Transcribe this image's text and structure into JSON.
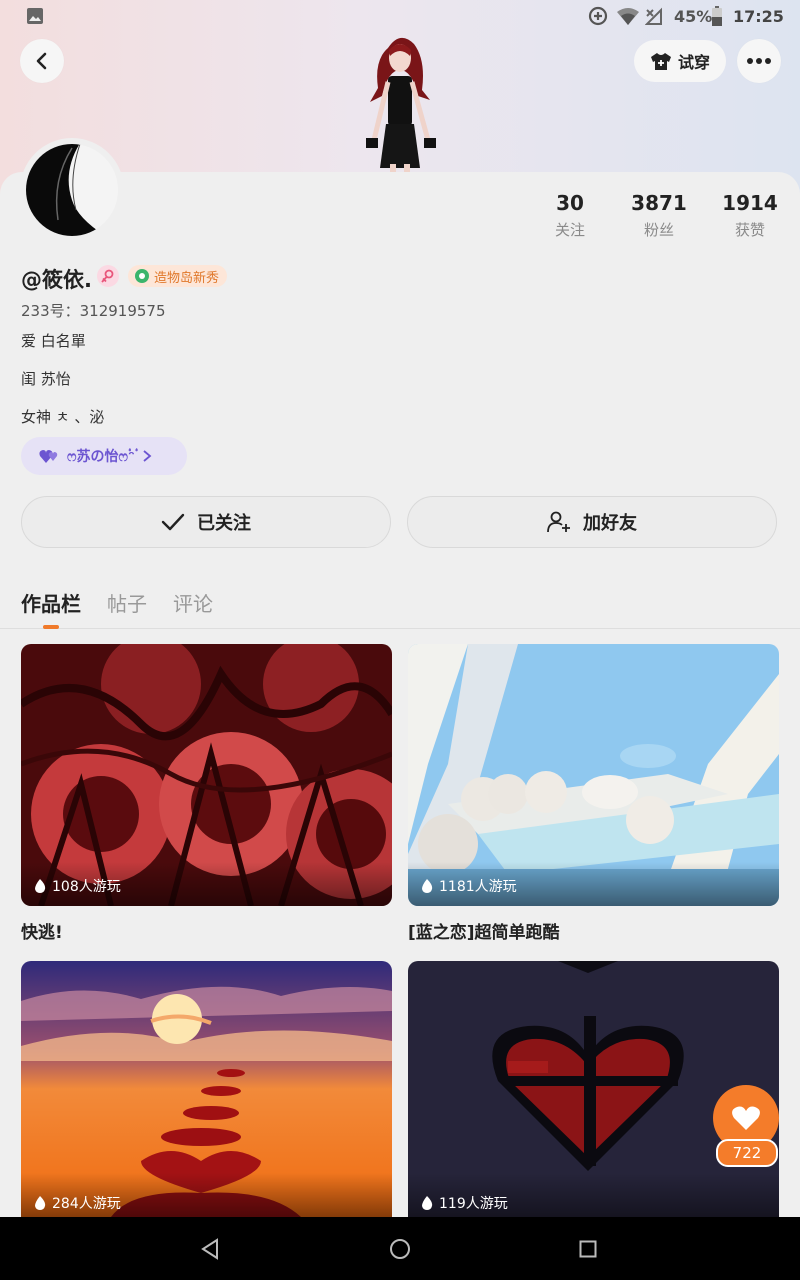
{
  "status_bar": {
    "battery": "45%",
    "time": "17:25",
    "icons": [
      "gallery-icon",
      "data-saver-icon",
      "wifi-icon",
      "no-signal-icon",
      "battery-icon"
    ]
  },
  "header": {
    "back_icon": "chevron-left-icon",
    "try_on_label": "试穿",
    "more_icon": "more-dots-icon"
  },
  "profile": {
    "username": "@筱依.",
    "badge_label": "造物岛新秀",
    "id_line": "233号：312919575",
    "bio_lines": [
      "爱 白名單",
      "闺 苏怡",
      "女神 ㅊ 、泌"
    ],
    "relation_pill": "ෆ苏の怡ෆ۟ᵔ۟",
    "stats": [
      {
        "value": "30",
        "label": "关注"
      },
      {
        "value": "3871",
        "label": "粉丝"
      },
      {
        "value": "1914",
        "label": "获赞"
      }
    ],
    "follow_label": "已关注",
    "add_friend_label": "加好友"
  },
  "tabs": [
    "作品栏",
    "帖子",
    "评论"
  ],
  "active_tab": "作品栏",
  "games": [
    {
      "title": "快逃!",
      "plays": "108人游玩"
    },
    {
      "title": "[蓝之恋]超简单跑酷",
      "plays": "1181人游玩"
    },
    {
      "title": "",
      "plays": "284人游玩"
    },
    {
      "title": "",
      "plays": "119人游玩"
    }
  ],
  "like_button": {
    "count": "722"
  },
  "colors": {
    "accent": "#f47c2a",
    "pill_text": "#6c55d1",
    "badge_text": "#e0782b"
  }
}
